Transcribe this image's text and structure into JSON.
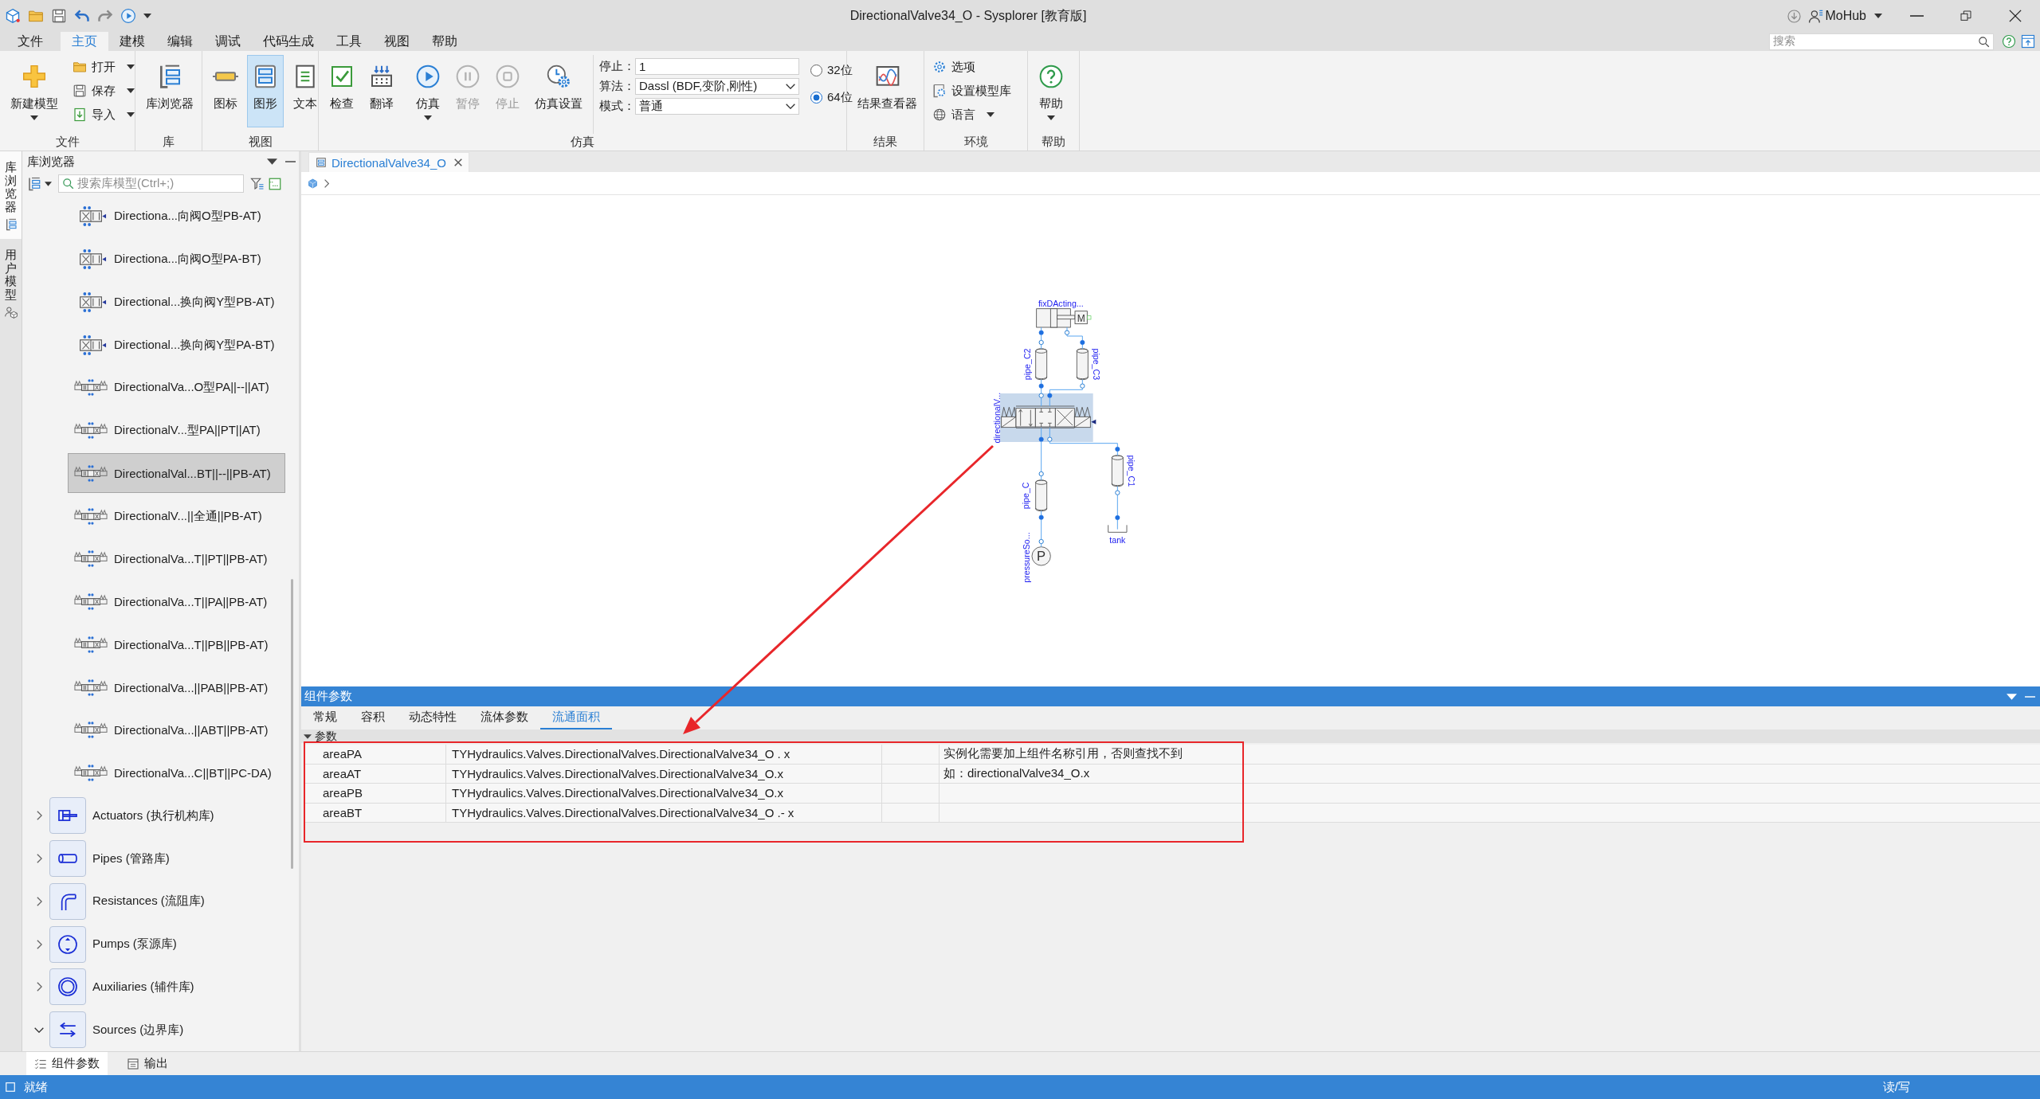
{
  "window": {
    "title": "DirectionalValve34_O - Sysplorer [教育版]",
    "user": "MoHub",
    "search": {
      "placeholder": "搜索"
    }
  },
  "menu_tabs": [
    {
      "label": "文件",
      "selected": false
    },
    {
      "label": "主页",
      "selected": true
    },
    {
      "label": "建模",
      "selected": false
    },
    {
      "label": "编辑",
      "selected": false
    },
    {
      "label": "调试",
      "selected": false
    },
    {
      "label": "代码生成",
      "selected": false
    },
    {
      "label": "工具",
      "selected": false
    },
    {
      "label": "视图",
      "selected": false
    },
    {
      "label": "帮助",
      "selected": false
    }
  ],
  "ribbon": {
    "groups": [
      {
        "label": "文件",
        "large": [
          {
            "label": "新建模型",
            "dropdown": true
          }
        ],
        "small": [
          {
            "label": "打开",
            "dropdown": true
          },
          {
            "label": "保存",
            "dropdown": true
          },
          {
            "label": "导入",
            "dropdown": true
          }
        ]
      },
      {
        "label": "库",
        "large": [
          {
            "label": "库浏览器",
            "dropdown": false
          }
        ]
      },
      {
        "label": "视图",
        "large": [
          {
            "label": "图标",
            "selected": false
          },
          {
            "label": "图形",
            "selected": true
          },
          {
            "label": "文本",
            "selected": false
          }
        ]
      },
      {
        "label": "仿真",
        "large": [
          {
            "label": "检查",
            "dropdown": false,
            "disabled": false
          },
          {
            "label": "翻译",
            "dropdown": false,
            "disabled": false
          },
          {
            "label": "仿真",
            "dropdown": true,
            "disabled": false
          },
          {
            "label": "暂停",
            "dropdown": false,
            "disabled": true
          },
          {
            "label": "停止",
            "dropdown": false,
            "disabled": true
          },
          {
            "label": "仿真设置",
            "dropdown": false,
            "disabled": false
          }
        ],
        "fields": [
          {
            "label": "停止：",
            "value": "1",
            "kind": "text"
          },
          {
            "label": "算法：",
            "value": "Dassl (BDF,变阶,刚性)",
            "kind": "select"
          },
          {
            "label": "模式：",
            "value": "普通",
            "kind": "select"
          }
        ],
        "radios": [
          {
            "label": "32位",
            "selected": false
          },
          {
            "label": "64位",
            "selected": true
          }
        ]
      },
      {
        "label": "结果",
        "large": [
          {
            "label": "结果查看器",
            "dropdown": false
          }
        ]
      },
      {
        "label": "环境",
        "small": [
          {
            "label": "选项",
            "dropdown": false
          },
          {
            "label": "设置模型库",
            "dropdown": false
          },
          {
            "label": "语言",
            "dropdown": true
          }
        ]
      },
      {
        "label": "帮助",
        "large": [
          {
            "label": "帮助",
            "dropdown": true
          }
        ]
      }
    ]
  },
  "side_tabs": [
    {
      "label": "库浏览器",
      "selected": true
    },
    {
      "label": "用户模型",
      "selected": false
    }
  ],
  "library": {
    "title": "库浏览器",
    "search": {
      "placeholder": "搜索库模型(Ctrl+;)"
    },
    "models": [
      {
        "label": "Directiona...向阀O型PB-AT)",
        "selected": false
      },
      {
        "label": "Directiona...向阀O型PA-BT)",
        "selected": false
      },
      {
        "label": "Directional...换向阀Y型PB-AT)",
        "selected": false
      },
      {
        "label": "Directional...换向阀Y型PA-BT)",
        "selected": false
      },
      {
        "label": "DirectionalVa...O型PA||--||AT)",
        "selected": false
      },
      {
        "label": "DirectionalV...型PA||PT||AT)",
        "selected": false
      },
      {
        "label": "DirectionalVal...BT||--||PB-AT)",
        "selected": true
      },
      {
        "label": "DirectionalV...||全通||PB-AT)",
        "selected": false
      },
      {
        "label": "DirectionalVa...T||PT||PB-AT)",
        "selected": false
      },
      {
        "label": "DirectionalVa...T||PA||PB-AT)",
        "selected": false
      },
      {
        "label": "DirectionalVa...T||PB||PB-AT)",
        "selected": false
      },
      {
        "label": "DirectionalVa...||PAB||PB-AT)",
        "selected": false
      },
      {
        "label": "DirectionalVa...||ABT||PB-AT)",
        "selected": false
      },
      {
        "label": "DirectionalVa...C||BT||PC-DA)",
        "selected": false
      }
    ],
    "packages": [
      {
        "label": "Actuators (执行机构库)",
        "expanded": false
      },
      {
        "label": "Pipes (管路库)",
        "expanded": false
      },
      {
        "label": "Resistances (流阻库)",
        "expanded": false
      },
      {
        "label": "Pumps (泵源库)",
        "expanded": false
      },
      {
        "label": "Auxiliaries (辅件库)",
        "expanded": false
      },
      {
        "label": "Sources (边界库)",
        "expanded": true
      }
    ]
  },
  "document_tabs": [
    {
      "label": "DirectionalValve34_O",
      "selected": true
    }
  ],
  "diagram": {
    "components": [
      {
        "label": "fixDActing...",
        "kind": "cylinder",
        "letter": "M",
        "selected": false
      },
      {
        "label": "pipe_C2",
        "kind": "pipe",
        "selected": false
      },
      {
        "label": "pipe_C3",
        "kind": "pipe",
        "selected": false
      },
      {
        "label": "directionalV...",
        "kind": "valve",
        "selected": true
      },
      {
        "label": "pipe_C1",
        "kind": "pipe",
        "selected": false
      },
      {
        "label": "pipe_C",
        "kind": "pipe",
        "selected": false
      },
      {
        "label": "tank",
        "kind": "tank",
        "selected": false
      },
      {
        "label": "pressureSo...",
        "kind": "pressure_source",
        "letter": "P",
        "selected": false
      }
    ]
  },
  "parameters": {
    "title": "组件参数",
    "tabs": [
      {
        "label": "常规",
        "selected": false
      },
      {
        "label": "容积",
        "selected": false
      },
      {
        "label": "动态特性",
        "selected": false
      },
      {
        "label": "流体参数",
        "selected": false
      },
      {
        "label": "流通面积",
        "selected": true
      }
    ],
    "section": {
      "label": "参数",
      "expanded": true
    },
    "rows": [
      {
        "name": "areaPA",
        "value": "TYHydraulics.Valves.DirectionalValves.DirectionalValve34_O . x",
        "description": "实例化需要加上组件名称引用，否则查找不到"
      },
      {
        "name": "areaAT",
        "value": "TYHydraulics.Valves.DirectionalValves.DirectionalValve34_O.x",
        "description": "如：directionalValve34_O.x"
      },
      {
        "name": "areaPB",
        "value": "TYHydraulics.Valves.DirectionalValves.DirectionalValve34_O.x"
      },
      {
        "name": "areaBT",
        "value": "TYHydraulics.Valves.DirectionalValves.DirectionalValve34_O .- x"
      }
    ]
  },
  "bottom_tabs": [
    {
      "label": "组件参数",
      "selected": true
    },
    {
      "label": "输出",
      "selected": false
    }
  ],
  "status_bar": {
    "message": "就绪",
    "mode": "读/写"
  }
}
